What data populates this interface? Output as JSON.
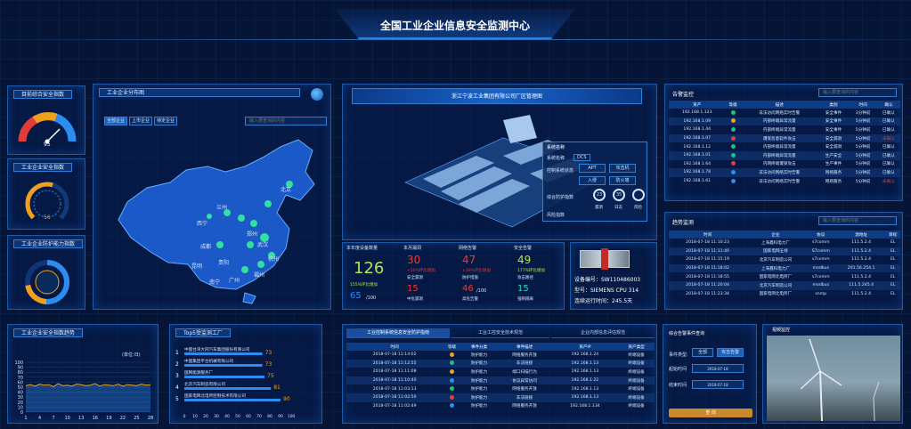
{
  "title": "全国工业企业信息安全监测中心",
  "gauges": {
    "g1": {
      "title": "目前综合安全指数",
      "value": "95",
      "min": "0",
      "max": "100"
    },
    "g2": {
      "title": "工业企业安全指数",
      "value": "56",
      "min": "0",
      "max": "100"
    },
    "g3": {
      "title": "工业企业防护能力指数",
      "value": "",
      "min": "0",
      "max": "100"
    }
  },
  "map": {
    "title": "工业企业分布图",
    "tabs": [
      "全部企业",
      "上市企业",
      "待定企业"
    ],
    "search_placeholder": "输入要查询的内容",
    "labels": [
      "安全局",
      "满洲里",
      "呼和浩特",
      "北京",
      "太原",
      "郑州",
      "武汉",
      "杭州",
      "上海",
      "南昌",
      "福州",
      "广州",
      "南宁",
      "昆明",
      "贵阳",
      "成都",
      "兰州",
      "西宁"
    ]
  },
  "factory": {
    "header": "浙江宁波工业集团有限公司厂区管理图",
    "overlay": {
      "header": "系统名称",
      "name_label": "系统名称",
      "name_value": "DCS",
      "ops_label": "控制系统状态",
      "btn_apt": "APT",
      "btn_attack": "攻击机",
      "btn_net": "入侵",
      "btn_fw": "防火墙",
      "security_label": "综合防护指数",
      "v1": "23",
      "v2": "35",
      "v3": "",
      "l1": "漏洞",
      "l2": "日志",
      "l3": "风险",
      "risk_label": "风险指数"
    }
  },
  "stats": [
    {
      "title": "本年度设备数量",
      "big": "126",
      "sub": "155%环比增加",
      "u1": "",
      "u2": "65",
      "u3": "/100"
    },
    {
      "title": "本月漏洞",
      "v": "30",
      "sub1": "+10%环比增加",
      "sub2": "安全漏洞",
      "v2": "15",
      "l2": "中危漏洞"
    },
    {
      "title": "网络告警",
      "v": "47",
      "sub1": "+30%环比增加",
      "sub2": "防护措施",
      "v2": "46",
      "v2b": "/100",
      "l2": "高危告警"
    },
    {
      "title": "安全告警",
      "v": "49",
      "sub1": "177%环比增加",
      "sub2": "攻击路径",
      "v2": "15",
      "l2": "强制隔离"
    }
  ],
  "device": {
    "line1": "设备编号：SW110486003",
    "line2": "型号：SIEMENS CPU 314",
    "line3": "连续运行时间：245.5天"
  },
  "alerts": {
    "title": "告警监控",
    "search_placeholder": "输入要查询的内容",
    "cols": [
      "资产",
      "等级",
      "描述",
      "类别",
      "时间",
      "确认"
    ],
    "rows": [
      [
        "192.168.1.123",
        "",
        "非法访问网络实时告警",
        "安全事件",
        "3分钟前",
        "已确认"
      ],
      [
        "192.168.1.09",
        "",
        "内部终端异常流量",
        "安全事件",
        "5分钟前",
        "已确认"
      ],
      [
        "192.168.1.44",
        "",
        "内部终端异常流量",
        "安全事件",
        "5分钟前",
        "已确认"
      ],
      [
        "192.168.1.07",
        "",
        "遭受恶意软件攻击",
        "安全漏洞",
        "5分钟前",
        "未确认"
      ],
      [
        "192.168.1.12",
        "",
        "内部终端异常流量",
        "安全漏洞",
        "5分钟前",
        "已确认"
      ],
      [
        "192.168.1.01",
        "",
        "内部终端异常流量",
        "生产安全",
        "5分钟前",
        "已确认"
      ],
      [
        "192.168.1.64",
        "",
        "内网终端遭受攻击",
        "生产事件",
        "5分钟前",
        "已确认"
      ],
      [
        "192.168.1.78",
        "",
        "非法访问网络实时告警",
        "网络服务",
        "5分钟前",
        "已确认"
      ],
      [
        "192.168.1.61",
        "",
        "非法访问网络实时告警",
        "网络服务",
        "5分钟前",
        "未确认"
      ]
    ],
    "levels": [
      "#19c37d",
      "#f0a01c",
      "#19c37d",
      "#e33a3a",
      "#19c37d",
      "#19c37d",
      "#e33a3a",
      "#2d8cf0",
      "#2d8cf0"
    ]
  },
  "reports": {
    "title": "趋势监测",
    "search_placeholder": "输入要查询的内容",
    "cols": [
      "时间",
      "企业",
      "协议",
      "源地址",
      "目标"
    ],
    "rows": [
      [
        "2018-07-18 11:10:23",
        "上海鑫科电力厂",
        "s7comm",
        "111.5.2.4",
        "EL"
      ],
      [
        "2018-07-18 11:11:40",
        "国家电网五线",
        "S7comm",
        "111.5.2.4",
        "EL"
      ],
      [
        "2018-07-18 11:15:19",
        "北京汽车制造公司",
        "s7comm",
        "111.5.2.4",
        "EL"
      ],
      [
        "2018-07-18 11:18:02",
        "上海鑫科电力厂",
        "modbus",
        "201.56.254.1",
        "EL"
      ],
      [
        "2018-07-18 11:18:55",
        "国家电网北电所厂",
        "s7comm",
        "111.5.2.4",
        "EL"
      ],
      [
        "2018-07-18 11:20:04",
        "北京汽车制造公司",
        "modbus",
        "111.5.245.4",
        "EL"
      ],
      [
        "2018-07-18 11:23:34",
        "国家电网北电所厂",
        "snmp",
        "111.5.2.4",
        "EL"
      ]
    ]
  },
  "trend": {
    "title": "工业企业安全指数趋势",
    "unit": "(单位:日)",
    "y": [
      100,
      90,
      80,
      70,
      60,
      50,
      40,
      30,
      20,
      10,
      0
    ],
    "x": [
      "1",
      "4",
      "7",
      "10",
      "13",
      "16",
      "19",
      "22",
      "25",
      "28"
    ],
    "chart_data": {
      "type": "line",
      "values": [
        53,
        55,
        52,
        56,
        54,
        55,
        51,
        57,
        53,
        54,
        52,
        56,
        55,
        53,
        54,
        57,
        52,
        55,
        54,
        53,
        56,
        52,
        55,
        54,
        53,
        56,
        54,
        55
      ]
    }
  },
  "top": {
    "title": "Top5受监测工厂",
    "items": [
      {
        "rank": "1",
        "name": "中国台湾大同汽车集团股份有限公司",
        "value": "73",
        "pct": 0.73
      },
      {
        "rank": "2",
        "name": "中国集团平台机械有限公司",
        "value": "73",
        "pct": 0.73
      },
      {
        "rank": "3",
        "name": "国网能源服务厂",
        "value": "75",
        "pct": 0.75
      },
      {
        "rank": "4",
        "name": "北京汽车制造有限公司",
        "value": "81",
        "pct": 0.81
      },
      {
        "rank": "5",
        "name": "国家电网北电所控制技术有限公司",
        "value": "90",
        "pct": 0.9
      }
    ],
    "axis": [
      "0",
      "10",
      "20",
      "30",
      "40",
      "50",
      "60",
      "70",
      "80",
      "90",
      "100"
    ]
  },
  "events": {
    "tabs": [
      "工业控制系统信息安全防护指南",
      "工业工控安全技术规范",
      "企业内部信息评估规范"
    ],
    "cols": [
      "时间",
      "等级",
      "事件分类",
      "事件描述",
      "资产IP",
      "资产类型"
    ],
    "rows": [
      [
        "2018-07-18 11:14:02",
        "",
        "防护能力",
        "网络服务开放",
        "192.168.1.24",
        "终端设备"
      ],
      [
        "2018-07-18 11:12:55",
        "",
        "防护能力",
        "非法链接",
        "192.168.1.13",
        "终端设备"
      ],
      [
        "2018-07-18 11:11:08",
        "",
        "防护能力",
        "端口扫描行为",
        "192.168.1.13",
        "终端设备"
      ],
      [
        "2018-07-18 11:10:40",
        "",
        "防护能力",
        "协议异常访问",
        "192.168.1.22",
        "终端设备"
      ],
      [
        "2018-07-18 11:03:13",
        "",
        "防护能力",
        "网络服务开放",
        "192.168.1.13",
        "终端设备"
      ],
      [
        "2018-07-18 11:02:50",
        "",
        "防护能力",
        "非法链接",
        "192.168.1.13",
        "终端设备"
      ],
      [
        "2018-07-18 11:02:49",
        "",
        "防护能力",
        "网络服务开放",
        "192.168.1.134",
        "终端设备"
      ]
    ],
    "levels": [
      "#f0a01c",
      "#19c37d",
      "#f0a01c",
      "#2d8cf0",
      "#19c37d",
      "#e33a3a",
      "#2d8cf0"
    ]
  },
  "query": {
    "title": "综合告警事件查询",
    "l1": "事件类型:",
    "v1": "全部",
    "btn1": "攻击告警",
    "l2": "起始时间",
    "v2": "2018-07-18",
    "l3": "结束时间",
    "v3": "2018-07-18",
    "submit": "查 询"
  },
  "video": {
    "title": "视频监控"
  },
  "colors": {
    "accent": "#2d8cf0",
    "bg": "#061536",
    "gold": "#c88a2c"
  }
}
